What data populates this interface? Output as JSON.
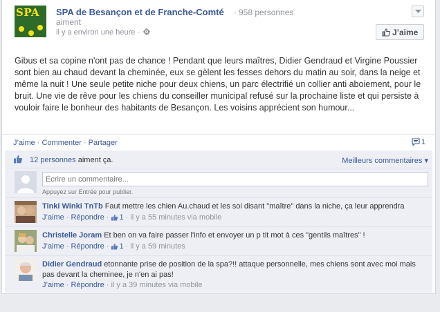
{
  "colors": {
    "link": "#3b5998",
    "muted": "#90949c",
    "ufi_bg": "#edeff4",
    "logo_bg": "#2f6b28",
    "logo_fg": "#f4e21d"
  },
  "header": {
    "logo_text": "SPA",
    "page_name": "SPA de Besançon et de Franche-Comté",
    "likes_count": "958 personnes",
    "aiment": "aiment",
    "time": "il y a environ une heure",
    "like_button": "J’aime",
    "privacy_icon": "gear-icon",
    "menu_icon": "chevron-down-icon"
  },
  "post": {
    "text": "Gibus et sa copine n'ont pas de chance ! Pendant que leurs maîtres, Didier Gendraud et Virgine Poussier sont bien au chaud devant la cheminée, eux se gèlent les fesses dehors du matin au soir, dans la neige et même la nuit ! Une seule petite niche pour deux chiens, un parc électrifié un collier anti aboiement, pour le bruit. Une vie de rêve pour les chiens du conseiller municipal refusé sur la prochaine liste et qui persiste à vouloir faire le bonheur des habitants de Besançon. Les voisins apprécient son humour..."
  },
  "actions": {
    "like": "J’aime",
    "comment": "Commenter",
    "share": "Partager",
    "comment_count": "1"
  },
  "ufi": {
    "likes_link": "12 personnes",
    "likes_suffix": "aiment ça.",
    "best_comments": "Meilleurs commentaires ▾",
    "composer_placeholder": "Écrire un commentaire...",
    "composer_hint": "Appuyez sur Entrée pour publier."
  },
  "comments": [
    {
      "author": "Tinki Winki TnTb",
      "text": "Faut mettre les chien Au.chaud et les soi disant \"maître\" dans la niche, ça leur apprendra",
      "like": "J’aime",
      "reply": "Répondre",
      "likes": "1",
      "time": "il y a 55 minutes via mobile"
    },
    {
      "author": "Christelle Joram",
      "text": "Et ben on va faire passer l'info et envoyer un p tit mot à ces \"gentils maîtres\" !",
      "like": "J’aime",
      "reply": "Répondre",
      "likes": "1",
      "time": "il y a 59 minutes"
    },
    {
      "author": "Didier Gendraud",
      "text": "etonnante prise de position de la spa?!! attaque personnelle, mes chiens sont avec moi mais pas devant la cheminee, je n'en ai pas!",
      "like": "J’aime",
      "reply": "Répondre",
      "time": "il y a 39 minutes via mobile"
    }
  ]
}
